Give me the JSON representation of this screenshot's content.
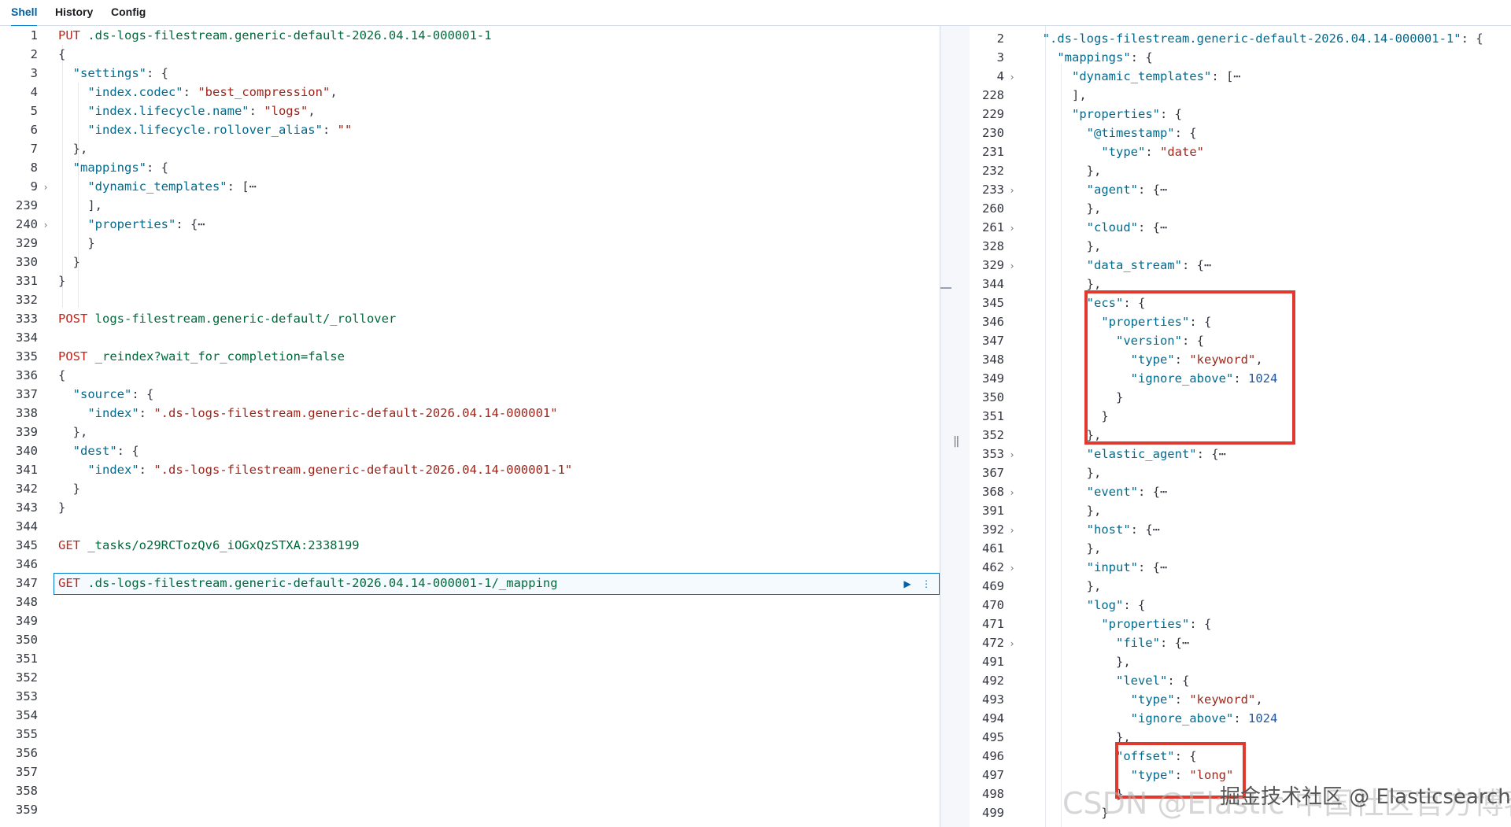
{
  "tabs": [
    {
      "label": "Shell",
      "active": true
    },
    {
      "label": "History",
      "active": false
    },
    {
      "label": "Config",
      "active": false
    }
  ],
  "colors": {
    "method": "#bd271e",
    "url": "#006b3c",
    "key": "#006b8f",
    "string": "#a0261c",
    "number": "#1e57a1",
    "highlight_box": "#e03a2e"
  },
  "icons": {
    "fold": "chevron-right-icon",
    "run": "play-icon",
    "more": "vertical-ellipsis-icon",
    "splitter": "drag-handle-icon"
  },
  "request_editor": {
    "active_line": "347",
    "lines": [
      {
        "n": "1",
        "fold": false,
        "t": [
          [
            "method",
            "PUT "
          ],
          [
            "url",
            ".ds-logs-filestream.generic-default-2026.04.14-000001-1"
          ]
        ]
      },
      {
        "n": "2",
        "fold": false,
        "t": [
          [
            "punc",
            "{"
          ]
        ]
      },
      {
        "n": "3",
        "fold": false,
        "t": [
          [
            "punc",
            "  "
          ],
          [
            "key",
            "\"settings\""
          ],
          [
            "punc",
            ": {"
          ]
        ]
      },
      {
        "n": "4",
        "fold": false,
        "t": [
          [
            "punc",
            "    "
          ],
          [
            "key",
            "\"index.codec\""
          ],
          [
            "punc",
            ": "
          ],
          [
            "str",
            "\"best_compression\""
          ],
          [
            "punc",
            ","
          ]
        ]
      },
      {
        "n": "5",
        "fold": false,
        "t": [
          [
            "punc",
            "    "
          ],
          [
            "key",
            "\"index.lifecycle.name\""
          ],
          [
            "punc",
            ": "
          ],
          [
            "str",
            "\"logs\""
          ],
          [
            "punc",
            ","
          ]
        ]
      },
      {
        "n": "6",
        "fold": false,
        "t": [
          [
            "punc",
            "    "
          ],
          [
            "key",
            "\"index.lifecycle.rollover_alias\""
          ],
          [
            "punc",
            ": "
          ],
          [
            "str",
            "\"\""
          ]
        ]
      },
      {
        "n": "7",
        "fold": false,
        "t": [
          [
            "punc",
            "  },"
          ]
        ]
      },
      {
        "n": "8",
        "fold": false,
        "t": [
          [
            "punc",
            "  "
          ],
          [
            "key",
            "\"mappings\""
          ],
          [
            "punc",
            ": {"
          ]
        ]
      },
      {
        "n": "9",
        "fold": true,
        "t": [
          [
            "punc",
            "    "
          ],
          [
            "key",
            "\"dynamic_templates\""
          ],
          [
            "punc",
            ": [⋯"
          ]
        ]
      },
      {
        "n": "239",
        "fold": false,
        "t": [
          [
            "punc",
            "    ],"
          ]
        ]
      },
      {
        "n": "240",
        "fold": true,
        "t": [
          [
            "punc",
            "    "
          ],
          [
            "key",
            "\"properties\""
          ],
          [
            "punc",
            ": {⋯"
          ]
        ]
      },
      {
        "n": "329",
        "fold": false,
        "t": [
          [
            "punc",
            "    }"
          ]
        ]
      },
      {
        "n": "330",
        "fold": false,
        "t": [
          [
            "punc",
            "  }"
          ]
        ]
      },
      {
        "n": "331",
        "fold": false,
        "t": [
          [
            "punc",
            "}"
          ]
        ]
      },
      {
        "n": "332",
        "fold": false,
        "t": []
      },
      {
        "n": "333",
        "fold": false,
        "t": [
          [
            "method",
            "POST "
          ],
          [
            "url",
            "logs-filestream.generic-default/_rollover"
          ]
        ]
      },
      {
        "n": "334",
        "fold": false,
        "t": []
      },
      {
        "n": "335",
        "fold": false,
        "t": [
          [
            "method",
            "POST "
          ],
          [
            "url",
            "_reindex?wait_for_completion=false"
          ]
        ]
      },
      {
        "n": "336",
        "fold": false,
        "t": [
          [
            "punc",
            "{"
          ]
        ]
      },
      {
        "n": "337",
        "fold": false,
        "t": [
          [
            "punc",
            "  "
          ],
          [
            "key",
            "\"source\""
          ],
          [
            "punc",
            ": {"
          ]
        ]
      },
      {
        "n": "338",
        "fold": false,
        "t": [
          [
            "punc",
            "    "
          ],
          [
            "key",
            "\"index\""
          ],
          [
            "punc",
            ": "
          ],
          [
            "str",
            "\".ds-logs-filestream.generic-default-2026.04.14-000001\""
          ]
        ]
      },
      {
        "n": "339",
        "fold": false,
        "t": [
          [
            "punc",
            "  },"
          ]
        ]
      },
      {
        "n": "340",
        "fold": false,
        "t": [
          [
            "punc",
            "  "
          ],
          [
            "key",
            "\"dest\""
          ],
          [
            "punc",
            ": {"
          ]
        ]
      },
      {
        "n": "341",
        "fold": false,
        "t": [
          [
            "punc",
            "    "
          ],
          [
            "key",
            "\"index\""
          ],
          [
            "punc",
            ": "
          ],
          [
            "str",
            "\".ds-logs-filestream.generic-default-2026.04.14-000001-1\""
          ]
        ]
      },
      {
        "n": "342",
        "fold": false,
        "t": [
          [
            "punc",
            "  }"
          ]
        ]
      },
      {
        "n": "343",
        "fold": false,
        "t": [
          [
            "punc",
            "}"
          ]
        ]
      },
      {
        "n": "344",
        "fold": false,
        "t": []
      },
      {
        "n": "345",
        "fold": false,
        "t": [
          [
            "method",
            "GET "
          ],
          [
            "url",
            "_tasks/o29RCTozQv6_iOGxQzSTXA:2338199"
          ]
        ]
      },
      {
        "n": "346",
        "fold": false,
        "t": []
      },
      {
        "n": "347",
        "fold": false,
        "t": [
          [
            "method",
            "GET "
          ],
          [
            "url",
            ".ds-logs-filestream.generic-default-2026.04.14-000001-1/_mapping"
          ]
        ]
      },
      {
        "n": "348",
        "fold": false,
        "t": []
      },
      {
        "n": "349",
        "fold": false,
        "t": []
      },
      {
        "n": "350",
        "fold": false,
        "t": []
      },
      {
        "n": "351",
        "fold": false,
        "t": []
      },
      {
        "n": "352",
        "fold": false,
        "t": []
      },
      {
        "n": "353",
        "fold": false,
        "t": []
      },
      {
        "n": "354",
        "fold": false,
        "t": []
      },
      {
        "n": "355",
        "fold": false,
        "t": []
      },
      {
        "n": "356",
        "fold": false,
        "t": []
      },
      {
        "n": "357",
        "fold": false,
        "t": []
      },
      {
        "n": "358",
        "fold": false,
        "t": []
      },
      {
        "n": "359",
        "fold": false,
        "t": []
      }
    ]
  },
  "response_viewer": {
    "lines": [
      {
        "n": "2",
        "fold": false,
        "t": [
          [
            "punc",
            "  "
          ],
          [
            "key",
            "\".ds-logs-filestream.generic-default-2026.04.14-000001-1\""
          ],
          [
            "punc",
            ": {"
          ]
        ]
      },
      {
        "n": "3",
        "fold": false,
        "t": [
          [
            "punc",
            "    "
          ],
          [
            "key",
            "\"mappings\""
          ],
          [
            "punc",
            ": {"
          ]
        ]
      },
      {
        "n": "4",
        "fold": true,
        "t": [
          [
            "punc",
            "      "
          ],
          [
            "key",
            "\"dynamic_templates\""
          ],
          [
            "punc",
            ": [⋯"
          ]
        ]
      },
      {
        "n": "228",
        "fold": false,
        "t": [
          [
            "punc",
            "      ],"
          ]
        ]
      },
      {
        "n": "229",
        "fold": false,
        "t": [
          [
            "punc",
            "      "
          ],
          [
            "key",
            "\"properties\""
          ],
          [
            "punc",
            ": {"
          ]
        ]
      },
      {
        "n": "230",
        "fold": false,
        "t": [
          [
            "punc",
            "        "
          ],
          [
            "key",
            "\"@timestamp\""
          ],
          [
            "punc",
            ": {"
          ]
        ]
      },
      {
        "n": "231",
        "fold": false,
        "t": [
          [
            "punc",
            "          "
          ],
          [
            "key",
            "\"type\""
          ],
          [
            "punc",
            ": "
          ],
          [
            "str",
            "\"date\""
          ]
        ]
      },
      {
        "n": "232",
        "fold": false,
        "t": [
          [
            "punc",
            "        },"
          ]
        ]
      },
      {
        "n": "233",
        "fold": true,
        "t": [
          [
            "punc",
            "        "
          ],
          [
            "key",
            "\"agent\""
          ],
          [
            "punc",
            ": {⋯"
          ]
        ]
      },
      {
        "n": "260",
        "fold": false,
        "t": [
          [
            "punc",
            "        },"
          ]
        ]
      },
      {
        "n": "261",
        "fold": true,
        "t": [
          [
            "punc",
            "        "
          ],
          [
            "key",
            "\"cloud\""
          ],
          [
            "punc",
            ": {⋯"
          ]
        ]
      },
      {
        "n": "328",
        "fold": false,
        "t": [
          [
            "punc",
            "        },"
          ]
        ]
      },
      {
        "n": "329",
        "fold": true,
        "t": [
          [
            "punc",
            "        "
          ],
          [
            "key",
            "\"data_stream\""
          ],
          [
            "punc",
            ": {⋯"
          ]
        ]
      },
      {
        "n": "344",
        "fold": false,
        "t": [
          [
            "punc",
            "        },"
          ]
        ]
      },
      {
        "n": "345",
        "fold": false,
        "t": [
          [
            "punc",
            "        "
          ],
          [
            "key",
            "\"ecs\""
          ],
          [
            "punc",
            ": {"
          ]
        ]
      },
      {
        "n": "346",
        "fold": false,
        "t": [
          [
            "punc",
            "          "
          ],
          [
            "key",
            "\"properties\""
          ],
          [
            "punc",
            ": {"
          ]
        ]
      },
      {
        "n": "347",
        "fold": false,
        "t": [
          [
            "punc",
            "            "
          ],
          [
            "key",
            "\"version\""
          ],
          [
            "punc",
            ": {"
          ]
        ]
      },
      {
        "n": "348",
        "fold": false,
        "t": [
          [
            "punc",
            "              "
          ],
          [
            "key",
            "\"type\""
          ],
          [
            "punc",
            ": "
          ],
          [
            "str",
            "\"keyword\""
          ],
          [
            "punc",
            ","
          ]
        ]
      },
      {
        "n": "349",
        "fold": false,
        "t": [
          [
            "punc",
            "              "
          ],
          [
            "key",
            "\"ignore_above\""
          ],
          [
            "punc",
            ": "
          ],
          [
            "num",
            "1024"
          ]
        ]
      },
      {
        "n": "350",
        "fold": false,
        "t": [
          [
            "punc",
            "            }"
          ]
        ]
      },
      {
        "n": "351",
        "fold": false,
        "t": [
          [
            "punc",
            "          }"
          ]
        ]
      },
      {
        "n": "352",
        "fold": false,
        "t": [
          [
            "punc",
            "        },"
          ]
        ]
      },
      {
        "n": "353",
        "fold": true,
        "t": [
          [
            "punc",
            "        "
          ],
          [
            "key",
            "\"elastic_agent\""
          ],
          [
            "punc",
            ": {⋯"
          ]
        ]
      },
      {
        "n": "367",
        "fold": false,
        "t": [
          [
            "punc",
            "        },"
          ]
        ]
      },
      {
        "n": "368",
        "fold": true,
        "t": [
          [
            "punc",
            "        "
          ],
          [
            "key",
            "\"event\""
          ],
          [
            "punc",
            ": {⋯"
          ]
        ]
      },
      {
        "n": "391",
        "fold": false,
        "t": [
          [
            "punc",
            "        },"
          ]
        ]
      },
      {
        "n": "392",
        "fold": true,
        "t": [
          [
            "punc",
            "        "
          ],
          [
            "key",
            "\"host\""
          ],
          [
            "punc",
            ": {⋯"
          ]
        ]
      },
      {
        "n": "461",
        "fold": false,
        "t": [
          [
            "punc",
            "        },"
          ]
        ]
      },
      {
        "n": "462",
        "fold": true,
        "t": [
          [
            "punc",
            "        "
          ],
          [
            "key",
            "\"input\""
          ],
          [
            "punc",
            ": {⋯"
          ]
        ]
      },
      {
        "n": "469",
        "fold": false,
        "t": [
          [
            "punc",
            "        },"
          ]
        ]
      },
      {
        "n": "470",
        "fold": false,
        "t": [
          [
            "punc",
            "        "
          ],
          [
            "key",
            "\"log\""
          ],
          [
            "punc",
            ": {"
          ]
        ]
      },
      {
        "n": "471",
        "fold": false,
        "t": [
          [
            "punc",
            "          "
          ],
          [
            "key",
            "\"properties\""
          ],
          [
            "punc",
            ": {"
          ]
        ]
      },
      {
        "n": "472",
        "fold": true,
        "t": [
          [
            "punc",
            "            "
          ],
          [
            "key",
            "\"file\""
          ],
          [
            "punc",
            ": {⋯"
          ]
        ]
      },
      {
        "n": "491",
        "fold": false,
        "t": [
          [
            "punc",
            "            },"
          ]
        ]
      },
      {
        "n": "492",
        "fold": false,
        "t": [
          [
            "punc",
            "            "
          ],
          [
            "key",
            "\"level\""
          ],
          [
            "punc",
            ": {"
          ]
        ]
      },
      {
        "n": "493",
        "fold": false,
        "t": [
          [
            "punc",
            "              "
          ],
          [
            "key",
            "\"type\""
          ],
          [
            "punc",
            ": "
          ],
          [
            "str",
            "\"keyword\""
          ],
          [
            "punc",
            ","
          ]
        ]
      },
      {
        "n": "494",
        "fold": false,
        "t": [
          [
            "punc",
            "              "
          ],
          [
            "key",
            "\"ignore_above\""
          ],
          [
            "punc",
            ": "
          ],
          [
            "num",
            "1024"
          ]
        ]
      },
      {
        "n": "495",
        "fold": false,
        "t": [
          [
            "punc",
            "            },"
          ]
        ]
      },
      {
        "n": "496",
        "fold": false,
        "t": [
          [
            "punc",
            "            "
          ],
          [
            "key",
            "\"offset\""
          ],
          [
            "punc",
            ": {"
          ]
        ]
      },
      {
        "n": "497",
        "fold": false,
        "t": [
          [
            "punc",
            "              "
          ],
          [
            "key",
            "\"type\""
          ],
          [
            "punc",
            ": "
          ],
          [
            "str",
            "\"long\""
          ]
        ]
      },
      {
        "n": "498",
        "fold": false,
        "t": [
          [
            "punc",
            "            }"
          ]
        ]
      },
      {
        "n": "499",
        "fold": false,
        "t": [
          [
            "punc",
            "          }"
          ]
        ]
      }
    ]
  },
  "watermark": "CSDN @Elastic 中国社区官方博客",
  "watermark_overlay": "掘金技术社区 @ Elasticsearch"
}
